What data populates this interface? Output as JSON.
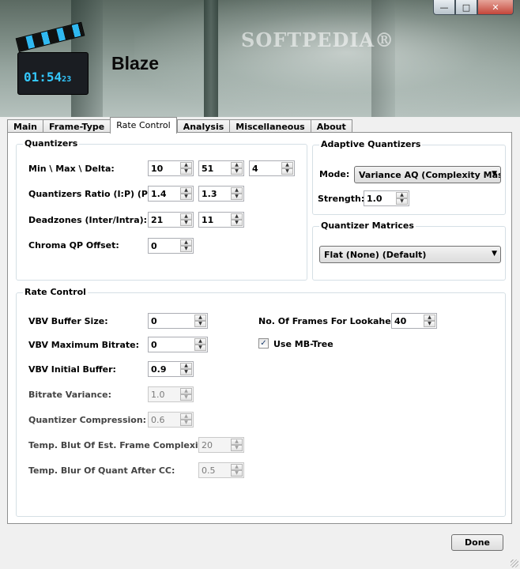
{
  "window": {
    "title": "Blaze",
    "watermark": "SOFTPEDIA®",
    "timer": "01:54",
    "timer_frames": "23",
    "controls": {
      "minimize": "—",
      "maximize": "□",
      "close": "✕"
    }
  },
  "tabs": [
    {
      "label": "Main"
    },
    {
      "label": "Frame-Type"
    },
    {
      "label": "Rate Control"
    },
    {
      "label": "Analysis"
    },
    {
      "label": "Miscellaneous"
    },
    {
      "label": "About"
    }
  ],
  "quantizers": {
    "title": "Quantizers",
    "min_max_delta_label": "Min \\ Max \\ Delta:",
    "min": "10",
    "max": "51",
    "delta": "4",
    "ratio_label": "Quantizers Ratio (I:P) (P:B):",
    "ratio_ip": "1.4",
    "ratio_pb": "1.3",
    "deadzones_label": "Deadzones (Inter/Intra):",
    "deadzone_inter": "21",
    "deadzone_intra": "11",
    "chroma_label": "Chroma QP Offset:",
    "chroma_offset": "0"
  },
  "adaptive": {
    "title": "Adaptive Quantizers",
    "mode_label": "Mode:",
    "mode_value": "Variance AQ (Complexity Mask)",
    "strength_label": "Strength:",
    "strength_value": "1.0"
  },
  "matrices": {
    "title": "Quantizer Matrices",
    "value": "Flat (None) (Default)"
  },
  "rate_control": {
    "title": "Rate Control",
    "vbv_buffer_label": "VBV Buffer Size:",
    "vbv_buffer": "0",
    "vbv_max_label": "VBV Maximum Bitrate:",
    "vbv_max": "0",
    "vbv_init_label": "VBV Initial Buffer:",
    "vbv_init": "0.9",
    "bitrate_var_label": "Bitrate Variance:",
    "bitrate_var": "1.0",
    "qcomp_label": "Quantizer Compression:",
    "qcomp": "0.6",
    "blur_complexity_label": "Temp. Blut Of Est. Frame Complexity:",
    "blur_complexity": "20",
    "blur_quant_label": "Temp. Blur Of Quant After CC:",
    "blur_quant": "0.5",
    "lookahead_label": "No. Of Frames For Lookahead:",
    "lookahead": "40",
    "mbtree_label": "Use MB-Tree",
    "mbtree_checked": true,
    "check_glyph": "✓"
  },
  "arrows": {
    "up": "▲",
    "down": "▼",
    "combo": "▼"
  },
  "footer": {
    "done_label": "Done"
  }
}
